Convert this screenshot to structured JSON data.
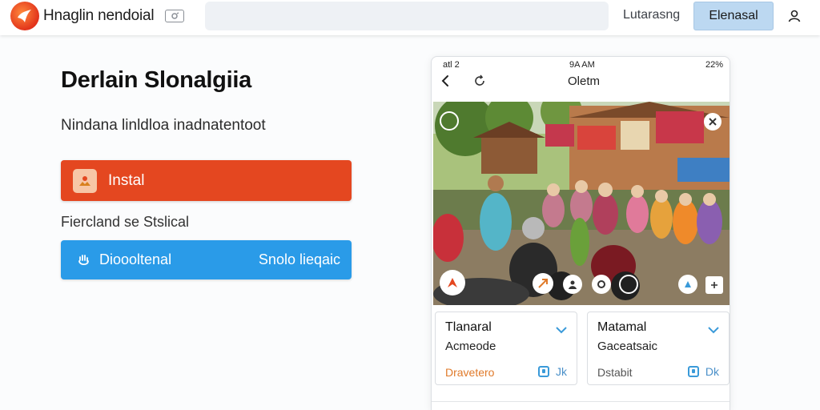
{
  "header": {
    "app_title": "Hnaglin nendoial",
    "search": {
      "value": "",
      "placeholder": ""
    },
    "link_label": "Lutarasng",
    "button_label": "Elenasal"
  },
  "main": {
    "heading": "Derlain Slonalgiia",
    "subtitle": "Nindana linldloa inadnatentoot",
    "install_label": "Instal",
    "secondary_text": "Fiercland se Stslical",
    "download_label": "Dioooltenal",
    "download_aux": "Snolo lieqaic"
  },
  "phone": {
    "status_left": "atl 2",
    "status_time": "9A AM",
    "status_right": "22%",
    "nav_title": "Oletm",
    "cards": [
      {
        "title": "Tlanaral",
        "subtitle": "Acmeode",
        "meta": "Dravetero",
        "meta_color": "#e07a2a",
        "action": "Jk"
      },
      {
        "title": "Matamal",
        "subtitle": "Gaceatsaic",
        "meta": "Dstabit",
        "meta_color": "#555555",
        "action": "Dk"
      }
    ]
  },
  "colors": {
    "install": "#e44720",
    "download": "#2a9be8",
    "header_button": "#bcd8f1",
    "link_accent": "#3a9ad9"
  },
  "icons": [
    "logo-icon",
    "chip-icon",
    "user-icon",
    "install-app-icon",
    "hand-icon",
    "back-icon",
    "refresh-icon",
    "chevron-down-icon",
    "check-icon"
  ]
}
